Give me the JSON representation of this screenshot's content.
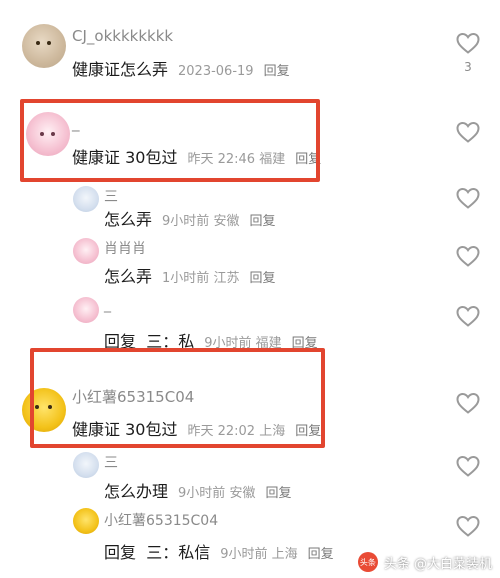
{
  "comments": [
    {
      "user": "CJ_okkkkkkkk",
      "text": "健康证怎么弄",
      "meta": "2023-06-19",
      "reply": "回复",
      "likes": "3"
    },
    {
      "user": "_",
      "text": "健康证 30包过",
      "meta": "昨天 22:46",
      "location": "福建",
      "reply": "回复"
    },
    {
      "user": "三",
      "text": "怎么弄",
      "meta": "9小时前",
      "location": "安徽",
      "reply": "回复"
    },
    {
      "user": "肖肖肖",
      "text": "怎么弄",
      "meta": "1小时前",
      "location": "江苏",
      "reply": "回复"
    },
    {
      "user": "_",
      "text": "回复",
      "reply_to": "三：私",
      "meta": "9小时前",
      "location": "福建",
      "reply": "回复"
    },
    {
      "user": "小红薯65315C04",
      "text": "健康证 30包过",
      "meta": "昨天 22:02",
      "location": "上海",
      "reply": "回复"
    },
    {
      "user": "三",
      "text": "怎么办理",
      "meta": "9小时前",
      "location": "安徽",
      "reply": "回复"
    },
    {
      "user": "小红薯65315C04",
      "text": "回复",
      "reply_to": "三：私信",
      "meta": "9小时前",
      "location": "上海",
      "reply": "回复"
    }
  ],
  "watermark": {
    "text": "头条 @大白菜装机",
    "logo": "头条"
  },
  "colors": {
    "highlight": "#e2452f",
    "heart": "#9a9a9a",
    "meta": "#9a9a9a"
  },
  "icons": {
    "like": "heart-outline-icon"
  }
}
